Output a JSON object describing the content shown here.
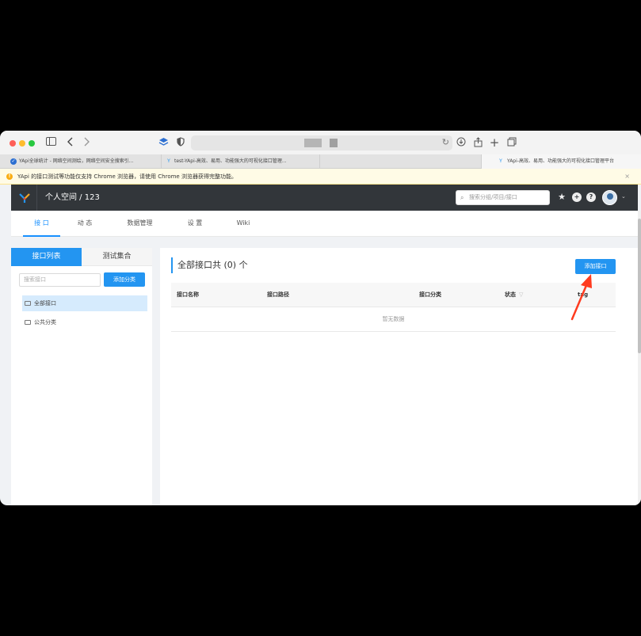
{
  "browser": {
    "tabs": [
      {
        "label": "YApi全球统计 - 网络空间测绘，网络空间安全搜索引..."
      },
      {
        "label": "test-YApi-高效、易用、功能强大的可视化接口管理..."
      },
      {
        "label": ""
      },
      {
        "label": "YApi-高效、易用、功能强大的可视化接口管理平台"
      }
    ]
  },
  "notice": {
    "text": "YApi 的接口测试等功能仅支持 Chrome 浏览器，请使用 Chrome 浏览器获得完整功能。",
    "close": "×"
  },
  "header": {
    "breadcrumb": "个人空间  /  123",
    "search_placeholder": "搜索分组/项目/接口"
  },
  "nav": {
    "tabs": [
      {
        "label": "接 口"
      },
      {
        "label": "动 态"
      },
      {
        "label": "数据管理"
      },
      {
        "label": "设 置"
      },
      {
        "label": "Wiki"
      }
    ]
  },
  "sidebar": {
    "tab_list": "接口列表",
    "tab_collection": "测试集合",
    "search_placeholder": "搜索接口",
    "add_category": "添加分类",
    "categories": [
      {
        "label": "全部接口"
      },
      {
        "label": "公共分类"
      }
    ]
  },
  "main": {
    "title": "全部接口共 (0) 个",
    "add_button": "添加接口",
    "columns": {
      "name": "接口名称",
      "path": "接口路径",
      "category": "接口分类",
      "status": "状态",
      "tag": "tag"
    },
    "empty": "暂无数据"
  },
  "colors": {
    "primary": "#2395f1",
    "header_bg": "#32363a",
    "arrow": "#ff3b1f"
  }
}
